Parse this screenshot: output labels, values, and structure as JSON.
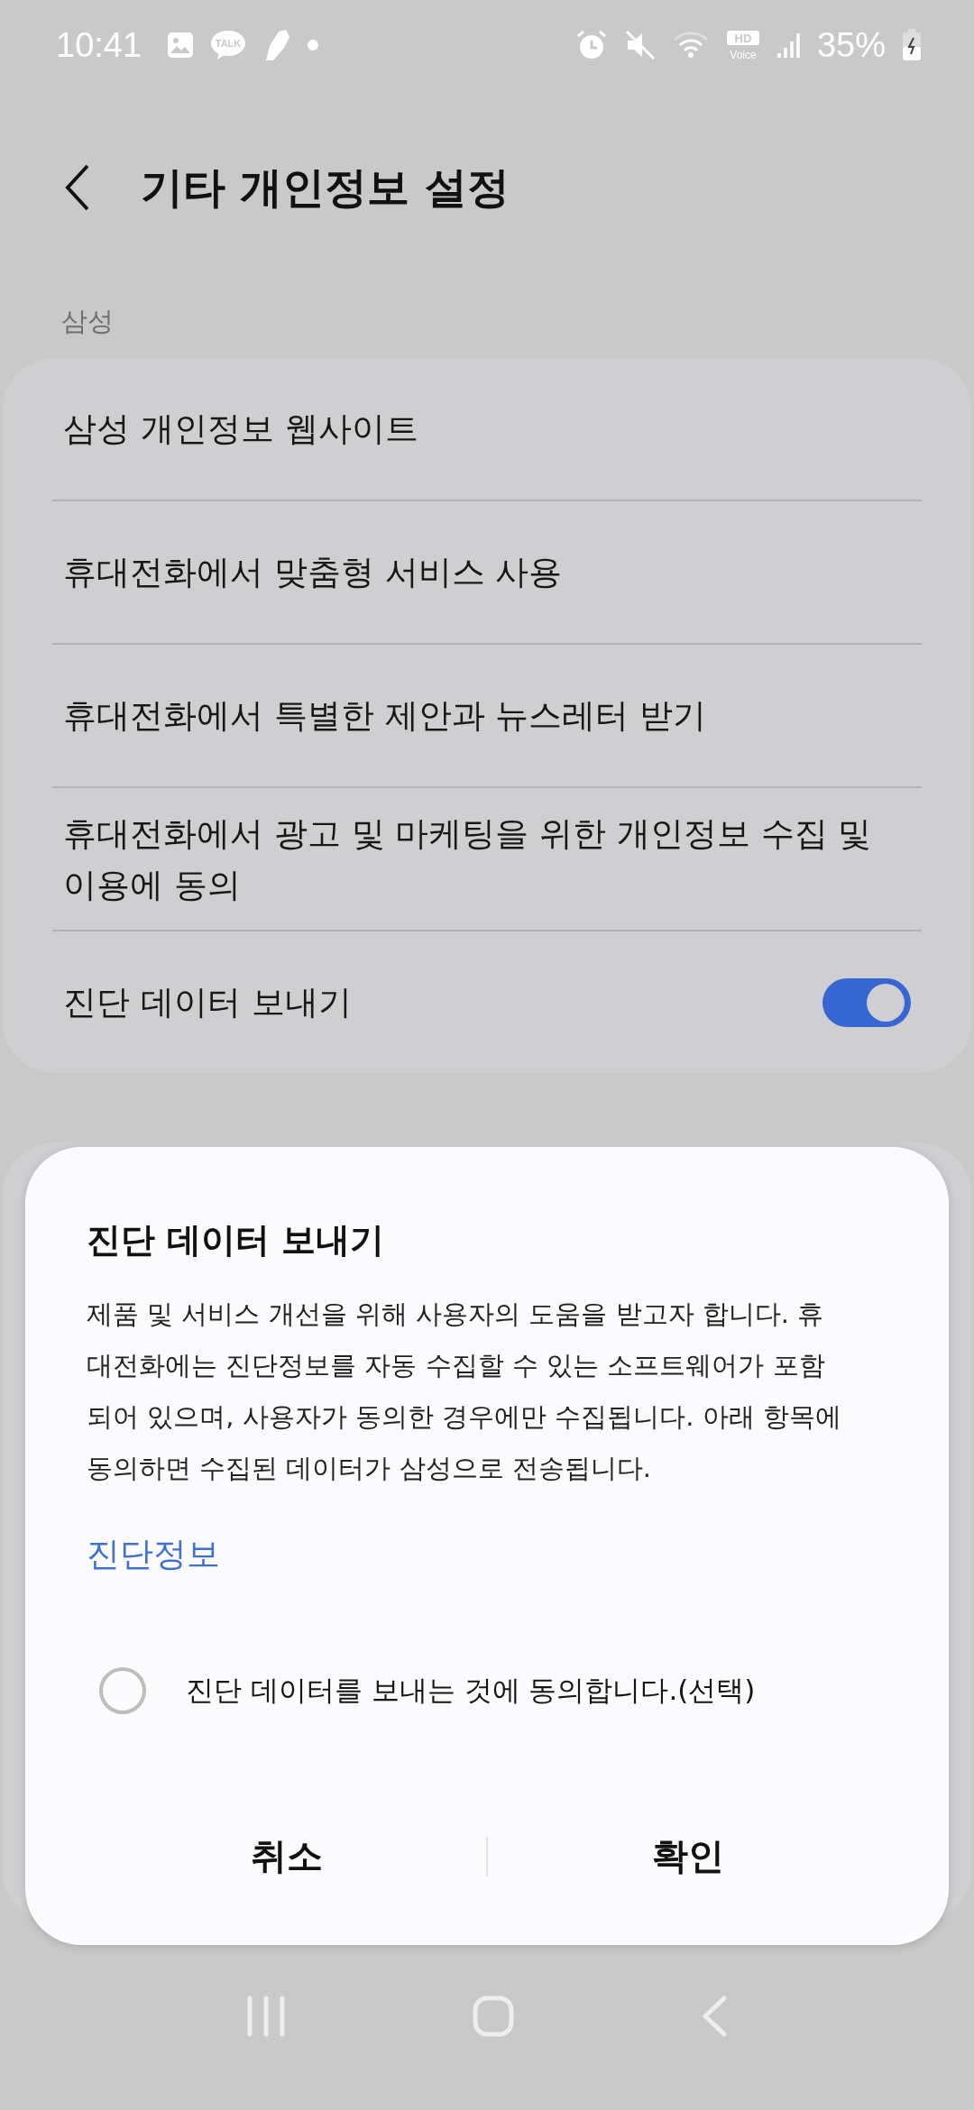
{
  "status_bar": {
    "time": "10:41",
    "talk_label": "TALK",
    "hd_label": "HD",
    "voice_label": "Voice",
    "battery": "35%"
  },
  "header": {
    "title": "기타 개인정보 설정"
  },
  "sections": [
    {
      "title": "삼성",
      "items": [
        {
          "label": "삼성 개인정보 웹사이트",
          "kind": "link"
        },
        {
          "label": "휴대전화에서 맞춤형 서비스 사용",
          "kind": "link"
        },
        {
          "label": "휴대전화에서 특별한 제안과 뉴스레터 받기",
          "kind": "link"
        },
        {
          "label": "휴대전화에서 광고 및 마케팅을 위한 개인정보 수집 및 이용에 동의",
          "kind": "link"
        },
        {
          "label": "진단 데이터 보내기",
          "kind": "toggle",
          "on": true
        }
      ]
    }
  ],
  "dialog": {
    "title": "진단 데이터 보내기",
    "body": "제품 및 서비스 개선을 위해 사용자의 도움을 받고자 합니다. 휴대전화에는 진단정보를 자동 수집할 수 있는 소프트웨어가 포함되어 있으며, 사용자가 동의한 경우에만 수집됩니다. 아래 항목에 동의하면 수집된 데이터가 삼성으로 전송됩니다.",
    "link": "진단정보",
    "option": {
      "label": "진단 데이터를 보내는 것에 동의합니다.(선택)",
      "checked": false
    },
    "buttons": [
      "취소",
      "확인"
    ]
  }
}
